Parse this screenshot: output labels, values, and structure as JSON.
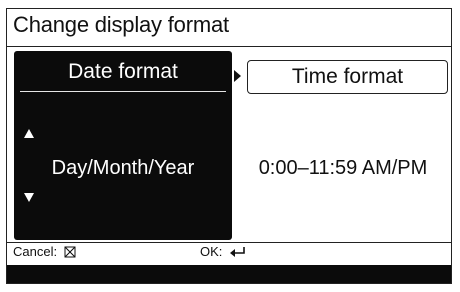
{
  "screen": {
    "title": "Change display format"
  },
  "date_panel": {
    "header": "Date format",
    "value": "Day/Month/Year",
    "up_icon": "triangle-up-icon",
    "down_icon": "triangle-down-icon"
  },
  "time_panel": {
    "header": "Time format",
    "value": "0:00–11:59 AM/PM",
    "pointer_icon": "triangle-right-icon"
  },
  "footer": {
    "cancel_label": "Cancel:",
    "cancel_icon": "cancel-box-x-icon",
    "ok_label": "OK:",
    "ok_icon": "enter-return-icon"
  },
  "colors": {
    "background": "#ffffff",
    "panel": "#0b0b0b",
    "text": "#111111",
    "panel_text": "#ffffff"
  }
}
